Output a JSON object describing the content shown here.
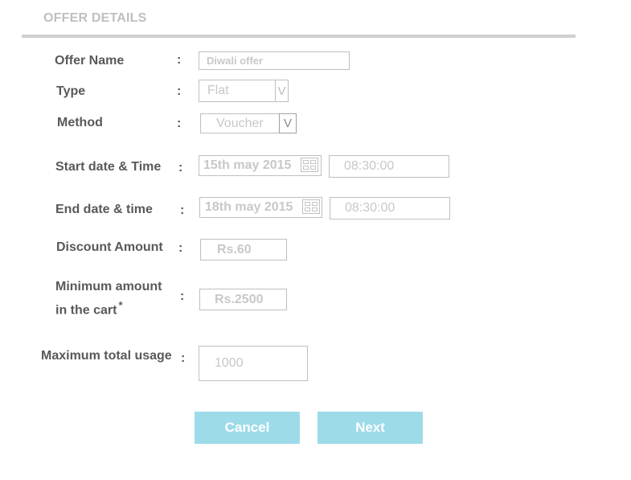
{
  "section": {
    "title": "OFFER DETAILS"
  },
  "form": {
    "offer_name": {
      "label": "Offer Name",
      "colon": ":",
      "value": "Diwali offer"
    },
    "type": {
      "label": "Type",
      "colon": ":",
      "value": "Flat",
      "arrow": "V"
    },
    "method": {
      "label": "Method",
      "colon": ":",
      "value": "Voucher",
      "arrow": "V"
    },
    "start": {
      "label": "Start date & Time",
      "colon": ":",
      "date": "15th may 2015",
      "time": "08:30:00"
    },
    "end": {
      "label": "End date & time",
      "colon": ":",
      "date": "18th may 2015",
      "time": "08:30:00"
    },
    "discount": {
      "label": "Discount Amount",
      "colon": ":",
      "value": "Rs.60"
    },
    "minimum": {
      "label_line1": "Minimum amount",
      "label_line2": "in the cart",
      "asterisk": "*",
      "colon": ":",
      "value": "Rs.2500"
    },
    "maximum": {
      "label": "Maximum total usage",
      "colon": ":",
      "value": "1000"
    }
  },
  "buttons": {
    "cancel": "Cancel",
    "next": "Next"
  },
  "colors": {
    "button_bg": "#9ddbe9",
    "label_text": "#595959",
    "field_text": "#c8c8c8",
    "rule": "#d0d0d0"
  },
  "icons": {
    "calendar": "calendar-icon",
    "dropdown": "chevron-down-icon"
  }
}
